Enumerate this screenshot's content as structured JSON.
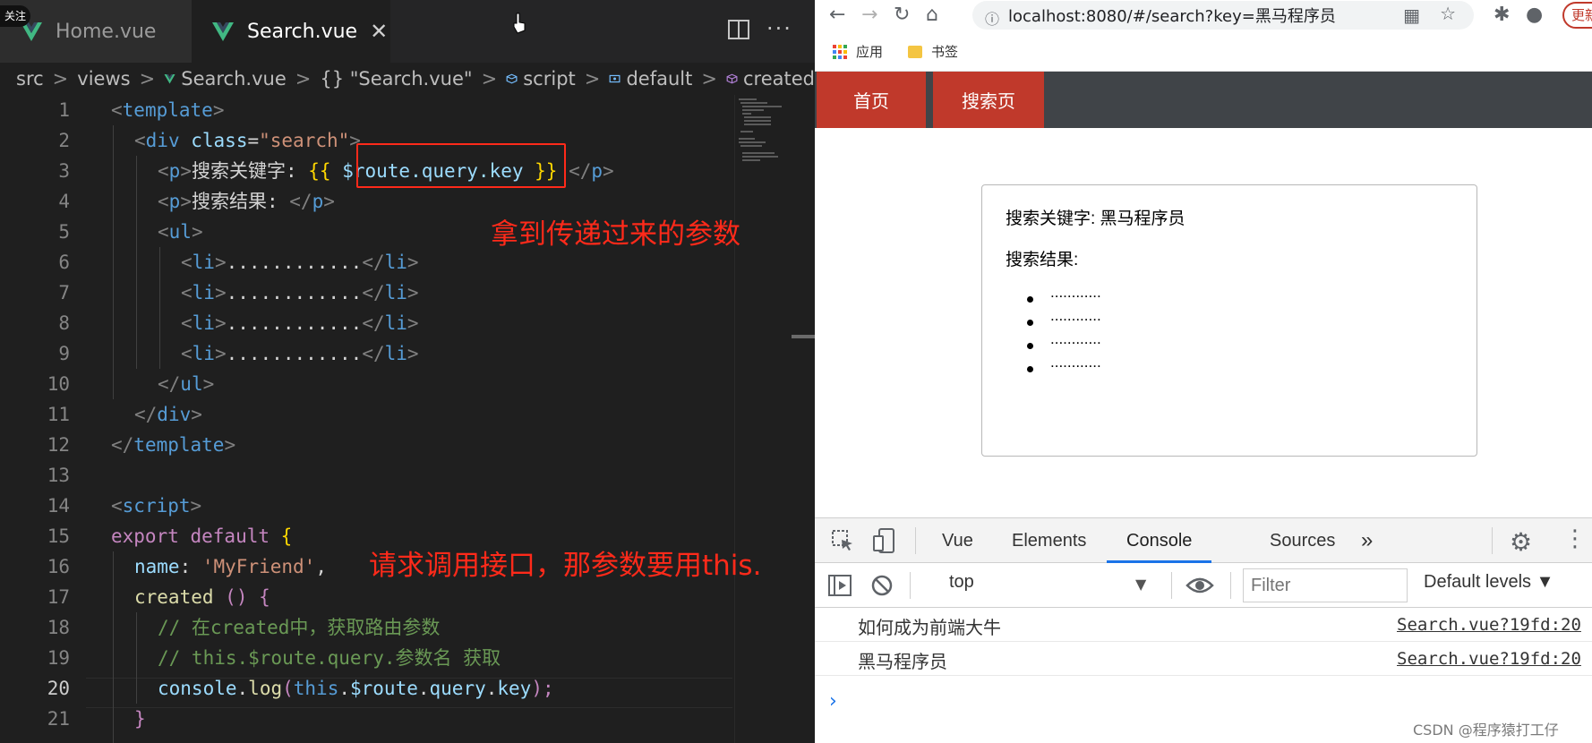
{
  "editor": {
    "tabs": [
      {
        "label": "Home.vue"
      },
      {
        "label": "Search.vue"
      }
    ],
    "follow_badge": "关注",
    "breadcrumb": [
      "src",
      "views",
      "Search.vue",
      "{} \"Search.vue\"",
      "script",
      "default",
      "created"
    ],
    "line_numbers": [
      "1",
      "2",
      "3",
      "4",
      "5",
      "6",
      "7",
      "8",
      "9",
      "10",
      "11",
      "12",
      "13",
      "14",
      "15",
      "16",
      "17",
      "18",
      "19",
      "20",
      "21"
    ],
    "active_line": "20",
    "code": {
      "l1": [
        "<",
        "template",
        ">"
      ],
      "l2": [
        "<",
        "div",
        "class",
        "=",
        "\"search\"",
        ">"
      ],
      "l3": [
        "<",
        "p",
        ">",
        "搜索关键字: ",
        "{{",
        " $route.query.key ",
        "}}",
        " </",
        "p",
        ">"
      ],
      "l4": [
        "<",
        "p",
        ">",
        "搜索结果: ",
        "</",
        "p",
        ">"
      ],
      "l5": [
        "<",
        "ul",
        ">"
      ],
      "li": [
        "<",
        "li",
        ">",
        "............",
        "</",
        "li",
        ">"
      ],
      "l10": [
        "</",
        "ul",
        ">"
      ],
      "l11": [
        "</",
        "div",
        ">"
      ],
      "l12": [
        "</",
        "template",
        ">"
      ],
      "l14": [
        "<",
        "script",
        ">"
      ],
      "l15": [
        "export",
        " default ",
        "{"
      ],
      "l16": [
        "name",
        ": ",
        "'MyFriend'",
        ","
      ],
      "l17": [
        "created",
        " ",
        "()",
        " {"
      ],
      "l18": "// 在created中，获取路由参数",
      "l19": "// this.$route.query.参数名 获取",
      "l20": [
        "console",
        ".",
        "log",
        "(",
        "this",
        ".",
        "$route",
        ".",
        "query",
        ".",
        "key",
        ");"
      ],
      "l21": "}"
    },
    "annotations": {
      "note1": "拿到传递过来的参数",
      "note2": "请求调用接口，那参数要用this."
    }
  },
  "browser": {
    "url": "localhost:8080/#/search?key=黑马程序员",
    "update_label": "更新",
    "bookmarks": {
      "apps": "应用",
      "folder": "书签"
    },
    "nav": {
      "home": "首页",
      "search": "搜索页"
    },
    "card": {
      "keyword_line": "搜索关键字: 黑马程序员",
      "result_label": "搜索结果:",
      "items": [
        "............",
        "............",
        "............",
        "............"
      ]
    },
    "devtools": {
      "tabs": [
        "Vue",
        "Elements",
        "Console",
        "Sources"
      ],
      "more": "»",
      "context": "top",
      "filter_placeholder": "Filter",
      "levels": "Default levels ▼",
      "logs": [
        {
          "message": "如何成为前端大牛",
          "source": "Search.vue?19fd:20"
        },
        {
          "message": "黑马程序员",
          "source": "Search.vue?19fd:20"
        }
      ],
      "prompt": "›"
    }
  },
  "watermark": "CSDN @程序猿打工仔",
  "colors": {
    "accent_red": "#c0392b",
    "annotation_red": "#ff2a1a",
    "vue_green": "#41b883",
    "devtools_blue": "#1a73e8"
  }
}
